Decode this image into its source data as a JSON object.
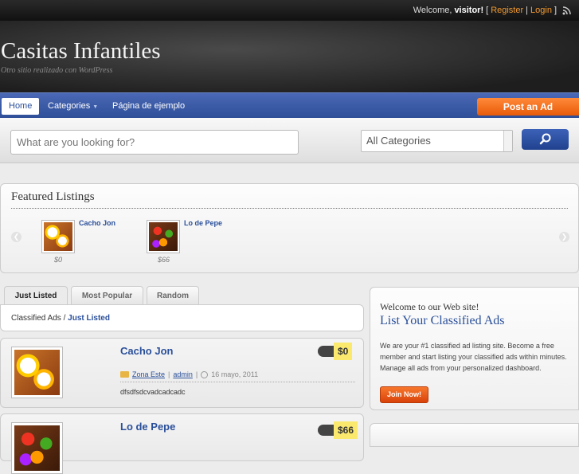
{
  "topbar": {
    "welcome_prefix": "Welcome,",
    "user": "visitor!",
    "bracket_open": "[",
    "register": "Register",
    "sep": "|",
    "login": "Login",
    "bracket_close": "]",
    "rss_icon": "rss-icon"
  },
  "header": {
    "site_title": "Casitas Infantiles",
    "tagline": "Otro sitio realizado con WordPress"
  },
  "nav": {
    "items": [
      {
        "label": "Home"
      },
      {
        "label": "Categories"
      },
      {
        "label": "Página de ejemplo"
      }
    ],
    "post_ad": "Post an Ad"
  },
  "search": {
    "placeholder": "What are you looking for?",
    "category_selected": "All Categories",
    "button_icon": "search-icon"
  },
  "featured": {
    "heading": "Featured Listings",
    "prev_icon": "chevron-left-icon",
    "next_icon": "chevron-right-icon",
    "items": [
      {
        "title": "Cacho Jon",
        "price": "$0"
      },
      {
        "title": "Lo de Pepe",
        "price": "$66"
      }
    ]
  },
  "tabs": [
    {
      "label": "Just Listed"
    },
    {
      "label": "Most Popular"
    },
    {
      "label": "Random"
    }
  ],
  "breadcrumb": {
    "root": "Classified Ads",
    "sep": "/",
    "current": "Just Listed"
  },
  "listings": [
    {
      "title": "Cacho Jon",
      "price": "$0",
      "category": "Zona Este",
      "author": "admin",
      "date": "16 mayo, 2011",
      "description": "dfsdfsdcvadcadcadc"
    },
    {
      "title": "Lo de Pepe",
      "price": "$66"
    }
  ],
  "sidebar": {
    "welcome": "Welcome to our Web site!",
    "title": "List Your Classified Ads",
    "text": "We are your #1 classified ad listing site. Become a free member and start listing your classified ads within minutes. Manage all ads from your personalized dashboard.",
    "join": "Join Now!"
  },
  "colors": {
    "nav_blue": "#3b5ba9",
    "accent_orange": "#f26a1b",
    "link_blue": "#2a4f9a",
    "price_yellow": "#fbe96e"
  }
}
